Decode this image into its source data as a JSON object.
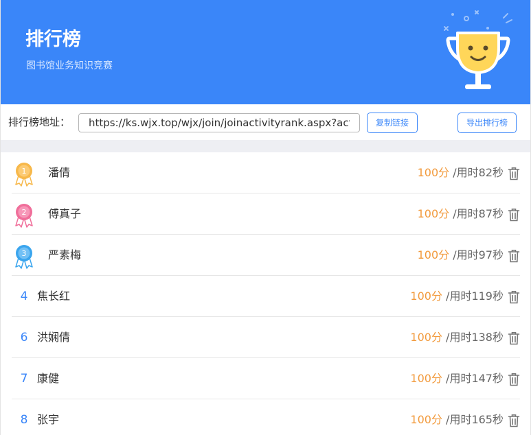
{
  "header": {
    "title": "排行榜",
    "subtitle": "图书馆业务知识竞赛"
  },
  "address": {
    "label": "排行榜地址：",
    "url": "https://ks.wjx.top/wjx/join/joinactivityrank.aspx?activity",
    "copy_label": "复制链接",
    "export_label": "导出排行榜"
  },
  "colors": {
    "primary": "#3a86f9",
    "score": "#f29a3c",
    "gold": "#f7b84a",
    "silver_pink": "#f06e9a",
    "bronze_blue": "#3aa5ee"
  },
  "ranking": [
    {
      "rank": "1",
      "medal": "gold",
      "name": "潘倩",
      "score": "100分",
      "time": " /用时82秒"
    },
    {
      "rank": "2",
      "medal": "pink",
      "name": "傅真子",
      "score": "100分",
      "time": " /用时87秒"
    },
    {
      "rank": "3",
      "medal": "blue",
      "name": "严素梅",
      "score": "100分",
      "time": " /用时97秒"
    },
    {
      "rank": "4",
      "medal": "",
      "name": "焦长红",
      "score": "100分",
      "time": " /用时119秒"
    },
    {
      "rank": "6",
      "medal": "",
      "name": "洪娴倩",
      "score": "100分",
      "time": " /用时138秒"
    },
    {
      "rank": "7",
      "medal": "",
      "name": "康健",
      "score": "100分",
      "time": " /用时147秒"
    },
    {
      "rank": "8",
      "medal": "",
      "name": "张宇",
      "score": "100分",
      "time": " /用时165秒"
    }
  ]
}
